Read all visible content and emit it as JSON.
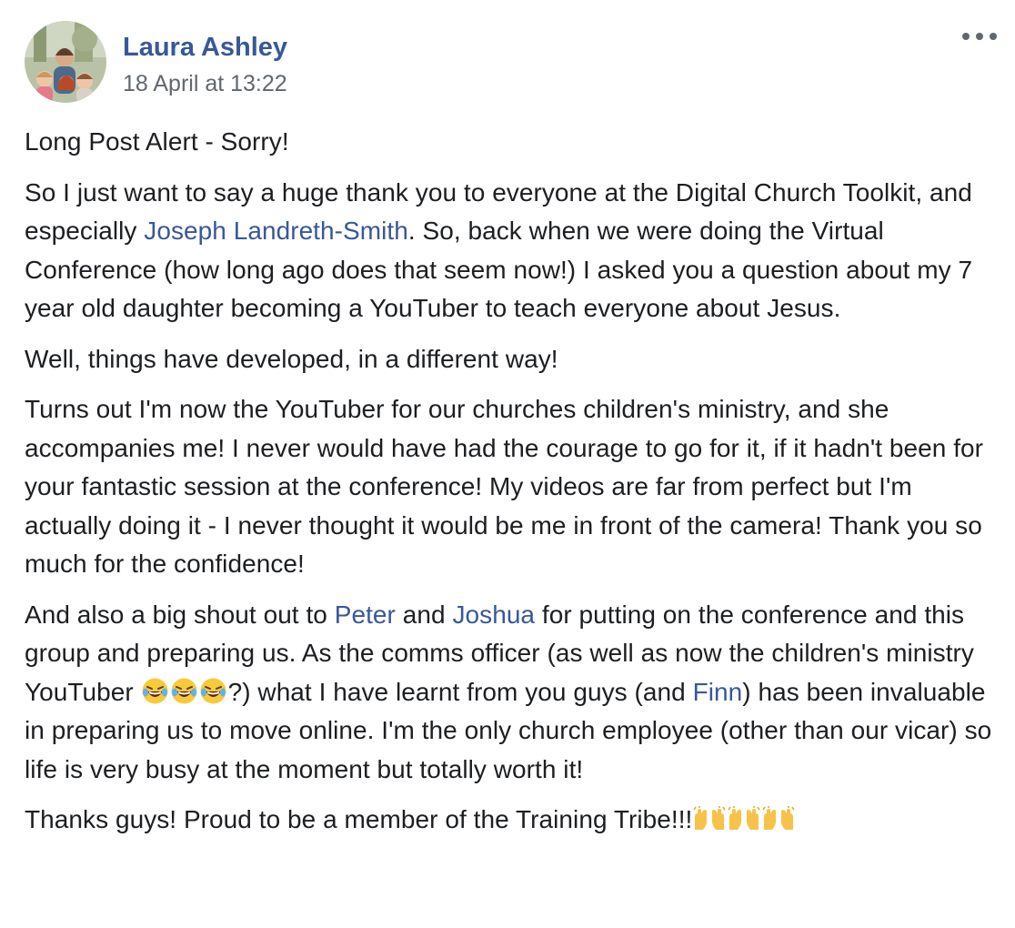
{
  "post": {
    "author": "Laura Ashley",
    "timestamp": "18 April at 13:22",
    "more_icon": "more-options-icon",
    "paragraphs": {
      "p1": "Long Post Alert - Sorry!",
      "p2": {
        "t1": "So I just want to say a huge thank you to everyone at the Digital Church Toolkit, and especially ",
        "mention": "Joseph Landreth-Smith",
        "t2": ". So, back when we were doing the Virtual Conference (how long ago does that seem now!) I asked you a question about my 7 year old daughter becoming a YouTuber to teach everyone about Jesus."
      },
      "p3": "Well, things have developed, in a different way!",
      "p4": "Turns out I'm now the YouTuber for our churches children's ministry, and she accompanies me! I never would have had the courage to go for it, if it hadn't been for your fantastic session at the conference! My videos are far from perfect but I'm actually doing it - I never thought it would be me in front of the camera! Thank you so much for the confidence!",
      "p5": {
        "t1": "And also a big shout out to ",
        "mention1": "Peter",
        "t2": " and ",
        "mention2": "Joshua",
        "t3": " for putting on the conference and this group and preparing us. As the comms officer (as well as now the children's ministry YouTuber ",
        "t4": "?) what I have learnt from you guys (and ",
        "mention3": "Finn",
        "t5": ") has been invaluable in preparing us to move online. I'm the only church employee (other than our vicar) so life is very busy at the moment but totally worth it!"
      },
      "p6": "Thanks guys! Proud to be a member of the Training Tribe!!!"
    },
    "colors": {
      "link": "#385898",
      "text": "#1c1e21",
      "muted": "#616770"
    }
  }
}
